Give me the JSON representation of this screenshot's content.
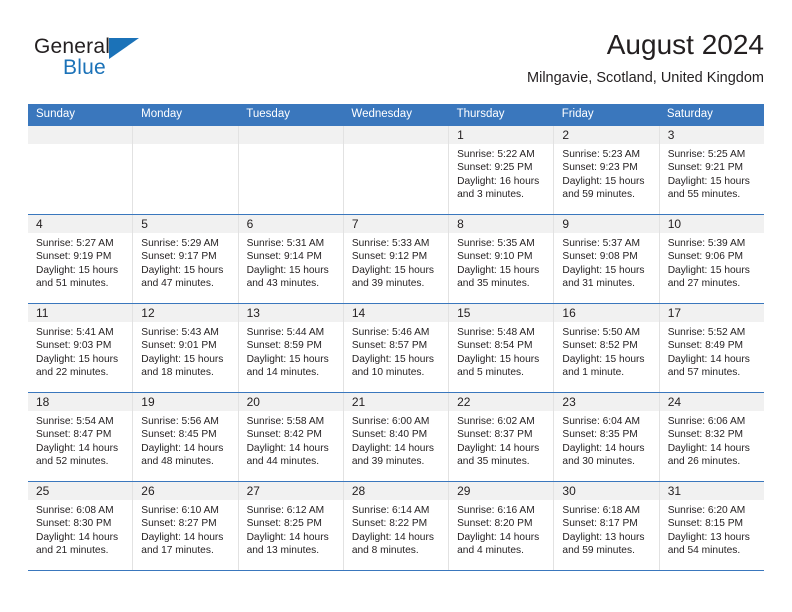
{
  "brand": {
    "name_part1": "General",
    "name_part2": "Blue",
    "triangle_color": "#1b72b8"
  },
  "header": {
    "title": "August 2024",
    "location": "Milngavie, Scotland, United Kingdom"
  },
  "theme": {
    "header_blue": "#3a77bd",
    "day_band_gray": "#f1f1f1",
    "cell_border": "#e2e2e2"
  },
  "weekdays": [
    "Sunday",
    "Monday",
    "Tuesday",
    "Wednesday",
    "Thursday",
    "Friday",
    "Saturday"
  ],
  "weeks": [
    [
      {
        "day": "",
        "sunrise": "",
        "sunset": "",
        "daylight1": "",
        "daylight2": ""
      },
      {
        "day": "",
        "sunrise": "",
        "sunset": "",
        "daylight1": "",
        "daylight2": ""
      },
      {
        "day": "",
        "sunrise": "",
        "sunset": "",
        "daylight1": "",
        "daylight2": ""
      },
      {
        "day": "",
        "sunrise": "",
        "sunset": "",
        "daylight1": "",
        "daylight2": ""
      },
      {
        "day": "1",
        "sunrise": "Sunrise: 5:22 AM",
        "sunset": "Sunset: 9:25 PM",
        "daylight1": "Daylight: 16 hours",
        "daylight2": "and 3 minutes."
      },
      {
        "day": "2",
        "sunrise": "Sunrise: 5:23 AM",
        "sunset": "Sunset: 9:23 PM",
        "daylight1": "Daylight: 15 hours",
        "daylight2": "and 59 minutes."
      },
      {
        "day": "3",
        "sunrise": "Sunrise: 5:25 AM",
        "sunset": "Sunset: 9:21 PM",
        "daylight1": "Daylight: 15 hours",
        "daylight2": "and 55 minutes."
      }
    ],
    [
      {
        "day": "4",
        "sunrise": "Sunrise: 5:27 AM",
        "sunset": "Sunset: 9:19 PM",
        "daylight1": "Daylight: 15 hours",
        "daylight2": "and 51 minutes."
      },
      {
        "day": "5",
        "sunrise": "Sunrise: 5:29 AM",
        "sunset": "Sunset: 9:17 PM",
        "daylight1": "Daylight: 15 hours",
        "daylight2": "and 47 minutes."
      },
      {
        "day": "6",
        "sunrise": "Sunrise: 5:31 AM",
        "sunset": "Sunset: 9:14 PM",
        "daylight1": "Daylight: 15 hours",
        "daylight2": "and 43 minutes."
      },
      {
        "day": "7",
        "sunrise": "Sunrise: 5:33 AM",
        "sunset": "Sunset: 9:12 PM",
        "daylight1": "Daylight: 15 hours",
        "daylight2": "and 39 minutes."
      },
      {
        "day": "8",
        "sunrise": "Sunrise: 5:35 AM",
        "sunset": "Sunset: 9:10 PM",
        "daylight1": "Daylight: 15 hours",
        "daylight2": "and 35 minutes."
      },
      {
        "day": "9",
        "sunrise": "Sunrise: 5:37 AM",
        "sunset": "Sunset: 9:08 PM",
        "daylight1": "Daylight: 15 hours",
        "daylight2": "and 31 minutes."
      },
      {
        "day": "10",
        "sunrise": "Sunrise: 5:39 AM",
        "sunset": "Sunset: 9:06 PM",
        "daylight1": "Daylight: 15 hours",
        "daylight2": "and 27 minutes."
      }
    ],
    [
      {
        "day": "11",
        "sunrise": "Sunrise: 5:41 AM",
        "sunset": "Sunset: 9:03 PM",
        "daylight1": "Daylight: 15 hours",
        "daylight2": "and 22 minutes."
      },
      {
        "day": "12",
        "sunrise": "Sunrise: 5:43 AM",
        "sunset": "Sunset: 9:01 PM",
        "daylight1": "Daylight: 15 hours",
        "daylight2": "and 18 minutes."
      },
      {
        "day": "13",
        "sunrise": "Sunrise: 5:44 AM",
        "sunset": "Sunset: 8:59 PM",
        "daylight1": "Daylight: 15 hours",
        "daylight2": "and 14 minutes."
      },
      {
        "day": "14",
        "sunrise": "Sunrise: 5:46 AM",
        "sunset": "Sunset: 8:57 PM",
        "daylight1": "Daylight: 15 hours",
        "daylight2": "and 10 minutes."
      },
      {
        "day": "15",
        "sunrise": "Sunrise: 5:48 AM",
        "sunset": "Sunset: 8:54 PM",
        "daylight1": "Daylight: 15 hours",
        "daylight2": "and 5 minutes."
      },
      {
        "day": "16",
        "sunrise": "Sunrise: 5:50 AM",
        "sunset": "Sunset: 8:52 PM",
        "daylight1": "Daylight: 15 hours",
        "daylight2": "and 1 minute."
      },
      {
        "day": "17",
        "sunrise": "Sunrise: 5:52 AM",
        "sunset": "Sunset: 8:49 PM",
        "daylight1": "Daylight: 14 hours",
        "daylight2": "and 57 minutes."
      }
    ],
    [
      {
        "day": "18",
        "sunrise": "Sunrise: 5:54 AM",
        "sunset": "Sunset: 8:47 PM",
        "daylight1": "Daylight: 14 hours",
        "daylight2": "and 52 minutes."
      },
      {
        "day": "19",
        "sunrise": "Sunrise: 5:56 AM",
        "sunset": "Sunset: 8:45 PM",
        "daylight1": "Daylight: 14 hours",
        "daylight2": "and 48 minutes."
      },
      {
        "day": "20",
        "sunrise": "Sunrise: 5:58 AM",
        "sunset": "Sunset: 8:42 PM",
        "daylight1": "Daylight: 14 hours",
        "daylight2": "and 44 minutes."
      },
      {
        "day": "21",
        "sunrise": "Sunrise: 6:00 AM",
        "sunset": "Sunset: 8:40 PM",
        "daylight1": "Daylight: 14 hours",
        "daylight2": "and 39 minutes."
      },
      {
        "day": "22",
        "sunrise": "Sunrise: 6:02 AM",
        "sunset": "Sunset: 8:37 PM",
        "daylight1": "Daylight: 14 hours",
        "daylight2": "and 35 minutes."
      },
      {
        "day": "23",
        "sunrise": "Sunrise: 6:04 AM",
        "sunset": "Sunset: 8:35 PM",
        "daylight1": "Daylight: 14 hours",
        "daylight2": "and 30 minutes."
      },
      {
        "day": "24",
        "sunrise": "Sunrise: 6:06 AM",
        "sunset": "Sunset: 8:32 PM",
        "daylight1": "Daylight: 14 hours",
        "daylight2": "and 26 minutes."
      }
    ],
    [
      {
        "day": "25",
        "sunrise": "Sunrise: 6:08 AM",
        "sunset": "Sunset: 8:30 PM",
        "daylight1": "Daylight: 14 hours",
        "daylight2": "and 21 minutes."
      },
      {
        "day": "26",
        "sunrise": "Sunrise: 6:10 AM",
        "sunset": "Sunset: 8:27 PM",
        "daylight1": "Daylight: 14 hours",
        "daylight2": "and 17 minutes."
      },
      {
        "day": "27",
        "sunrise": "Sunrise: 6:12 AM",
        "sunset": "Sunset: 8:25 PM",
        "daylight1": "Daylight: 14 hours",
        "daylight2": "and 13 minutes."
      },
      {
        "day": "28",
        "sunrise": "Sunrise: 6:14 AM",
        "sunset": "Sunset: 8:22 PM",
        "daylight1": "Daylight: 14 hours",
        "daylight2": "and 8 minutes."
      },
      {
        "day": "29",
        "sunrise": "Sunrise: 6:16 AM",
        "sunset": "Sunset: 8:20 PM",
        "daylight1": "Daylight: 14 hours",
        "daylight2": "and 4 minutes."
      },
      {
        "day": "30",
        "sunrise": "Sunrise: 6:18 AM",
        "sunset": "Sunset: 8:17 PM",
        "daylight1": "Daylight: 13 hours",
        "daylight2": "and 59 minutes."
      },
      {
        "day": "31",
        "sunrise": "Sunrise: 6:20 AM",
        "sunset": "Sunset: 8:15 PM",
        "daylight1": "Daylight: 13 hours",
        "daylight2": "and 54 minutes."
      }
    ]
  ]
}
